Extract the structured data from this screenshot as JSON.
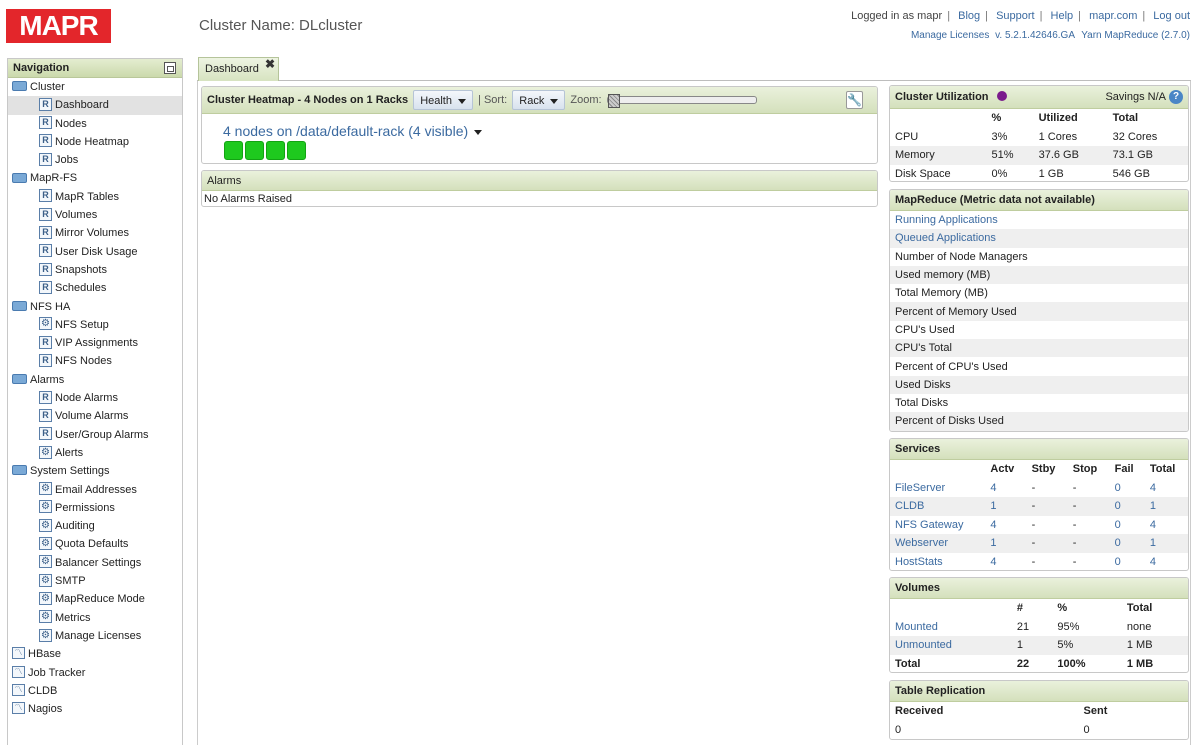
{
  "header": {
    "logo": "MAPR",
    "cluster_label": "Cluster Name: DLcluster",
    "links": [
      "Logged in as mapr",
      "Blog",
      "Support",
      "Help",
      "mapr.com",
      "Log out"
    ],
    "sub_links": [
      "Manage Licenses",
      "v. 5.2.1.42646.GA",
      "Yarn MapReduce (2.7.0)"
    ]
  },
  "nav": {
    "title": "Navigation",
    "items": [
      {
        "label": "Cluster",
        "kind": "grp",
        "icon": "folder-icon"
      },
      {
        "label": "Dashboard",
        "kind": "itm",
        "icon": "report-icon",
        "selected": true
      },
      {
        "label": "Nodes",
        "kind": "itm",
        "icon": "report-icon"
      },
      {
        "label": "Node Heatmap",
        "kind": "itm",
        "icon": "report-icon"
      },
      {
        "label": "Jobs",
        "kind": "itm",
        "icon": "report-icon"
      },
      {
        "label": "MapR-FS",
        "kind": "grp",
        "icon": "folder-icon"
      },
      {
        "label": "MapR Tables",
        "kind": "itm",
        "icon": "report-icon"
      },
      {
        "label": "Volumes",
        "kind": "itm",
        "icon": "report-icon"
      },
      {
        "label": "Mirror Volumes",
        "kind": "itm",
        "icon": "report-icon"
      },
      {
        "label": "User Disk Usage",
        "kind": "itm",
        "icon": "report-icon"
      },
      {
        "label": "Snapshots",
        "kind": "itm",
        "icon": "report-icon"
      },
      {
        "label": "Schedules",
        "kind": "itm",
        "icon": "report-icon"
      },
      {
        "label": "NFS HA",
        "kind": "grp",
        "icon": "folder-icon"
      },
      {
        "label": "NFS Setup",
        "kind": "itm",
        "icon": "gear-icon"
      },
      {
        "label": "VIP Assignments",
        "kind": "itm",
        "icon": "report-icon"
      },
      {
        "label": "NFS Nodes",
        "kind": "itm",
        "icon": "report-icon"
      },
      {
        "label": "Alarms",
        "kind": "grp",
        "icon": "folder-icon"
      },
      {
        "label": "Node Alarms",
        "kind": "itm",
        "icon": "report-icon"
      },
      {
        "label": "Volume Alarms",
        "kind": "itm",
        "icon": "report-icon"
      },
      {
        "label": "User/Group Alarms",
        "kind": "itm",
        "icon": "report-icon"
      },
      {
        "label": "Alerts",
        "kind": "itm",
        "icon": "gear-icon"
      },
      {
        "label": "System Settings",
        "kind": "grp",
        "icon": "folder-icon"
      },
      {
        "label": "Email Addresses",
        "kind": "itm",
        "icon": "gear-icon"
      },
      {
        "label": "Permissions",
        "kind": "itm",
        "icon": "gear-icon"
      },
      {
        "label": "Auditing",
        "kind": "itm",
        "icon": "gear-icon"
      },
      {
        "label": "Quota Defaults",
        "kind": "itm",
        "icon": "gear-icon"
      },
      {
        "label": "Balancer Settings",
        "kind": "itm",
        "icon": "gear-icon"
      },
      {
        "label": "SMTP",
        "kind": "itm",
        "icon": "gear-icon"
      },
      {
        "label": "MapReduce Mode",
        "kind": "itm",
        "icon": "gear-icon"
      },
      {
        "label": "Metrics",
        "kind": "itm",
        "icon": "gear-icon"
      },
      {
        "label": "Manage Licenses",
        "kind": "itm",
        "icon": "gear-icon"
      },
      {
        "label": "HBase",
        "kind": "grp",
        "icon": "chart-icon"
      },
      {
        "label": "Job Tracker",
        "kind": "grp",
        "icon": "chart-icon"
      },
      {
        "label": "CLDB",
        "kind": "grp",
        "icon": "chart-icon"
      },
      {
        "label": "Nagios",
        "kind": "grp",
        "icon": "chart-icon"
      }
    ]
  },
  "tab": {
    "label": "Dashboard",
    "close": "✖"
  },
  "heatmap": {
    "title": "Cluster Heatmap - 4 Nodes on 1 Racks",
    "health_label": "Health",
    "sort_label": "Sort:",
    "rack_label": "Rack",
    "zoom_label": "Zoom:",
    "rack_line": "4 nodes on /data/default-rack (4 visible)",
    "node_color": "#1ec91e",
    "node_count": 4
  },
  "alarms": {
    "title": "Alarms",
    "body": "No Alarms Raised"
  },
  "utilization": {
    "title": "Cluster Utilization",
    "savings": "Savings N/A",
    "headers": [
      "",
      "%",
      "Utilized",
      "Total"
    ],
    "rows": [
      [
        "CPU",
        "3%",
        "1 Cores",
        "32 Cores"
      ],
      [
        "Memory",
        "51%",
        "37.6 GB",
        "73.1 GB"
      ],
      [
        "Disk Space",
        "0%",
        "1 GB",
        "546 GB"
      ]
    ]
  },
  "mapreduce": {
    "title": "MapReduce (Metric data not available)",
    "rows": [
      "Running Applications",
      "Queued Applications",
      "Number of Node Managers",
      "Used memory (MB)",
      "Total Memory (MB)",
      "Percent of Memory Used",
      "CPU's Used",
      "CPU's Total",
      "Percent of CPU's Used",
      "Used Disks",
      "Total Disks",
      "Percent of Disks Used"
    ],
    "link_rows": [
      0,
      1
    ]
  },
  "services": {
    "title": "Services",
    "headers": [
      "",
      "Actv",
      "Stby",
      "Stop",
      "Fail",
      "Total"
    ],
    "rows": [
      [
        "FileServer",
        "4",
        "-",
        "-",
        "0",
        "4"
      ],
      [
        "CLDB",
        "1",
        "-",
        "-",
        "0",
        "1"
      ],
      [
        "NFS Gateway",
        "4",
        "-",
        "-",
        "0",
        "4"
      ],
      [
        "Webserver",
        "1",
        "-",
        "-",
        "0",
        "1"
      ],
      [
        "HostStats",
        "4",
        "-",
        "-",
        "0",
        "4"
      ]
    ]
  },
  "volumes": {
    "title": "Volumes",
    "headers": [
      "",
      "#",
      "%",
      "Total"
    ],
    "rows": [
      [
        "Mounted",
        "21",
        "95%",
        "none"
      ],
      [
        "Unmounted",
        "1",
        "5%",
        "1 MB"
      ],
      [
        "Total",
        "22",
        "100%",
        "1 MB"
      ]
    ]
  },
  "replication": {
    "title": "Table Replication",
    "headers": [
      "Received",
      "Sent"
    ],
    "rows": [
      [
        "0",
        "0"
      ]
    ]
  }
}
